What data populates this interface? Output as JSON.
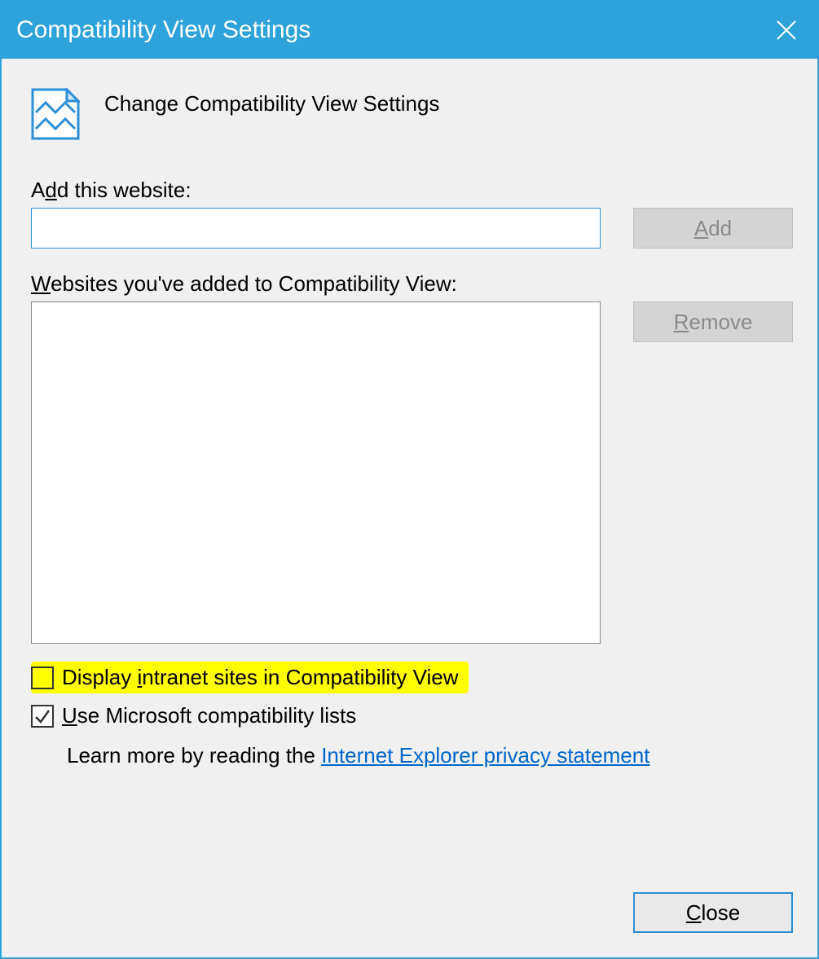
{
  "titlebar": {
    "title": "Compatibility View Settings"
  },
  "header": {
    "text": "Change Compatibility View Settings"
  },
  "add_section": {
    "label_pre": "A",
    "label_ul": "d",
    "label_post": "d this website:",
    "input_value": "",
    "button_ul": "A",
    "button_post": "dd"
  },
  "list_section": {
    "label_ul": "W",
    "label_post": "ebsites you've added to Compatibility View:",
    "remove_ul": "R",
    "remove_post": "emove"
  },
  "checkboxes": {
    "intranet": {
      "checked": false,
      "pre": "Display ",
      "ul": "i",
      "post": "ntranet sites in Compatibility View"
    },
    "mslists": {
      "checked": true,
      "ul": "U",
      "post": "se Microsoft compatibility lists"
    }
  },
  "learn": {
    "text": "Learn more by reading the ",
    "link": "Internet Explorer privacy statement"
  },
  "footer": {
    "close_ul": "C",
    "close_post": "lose"
  }
}
